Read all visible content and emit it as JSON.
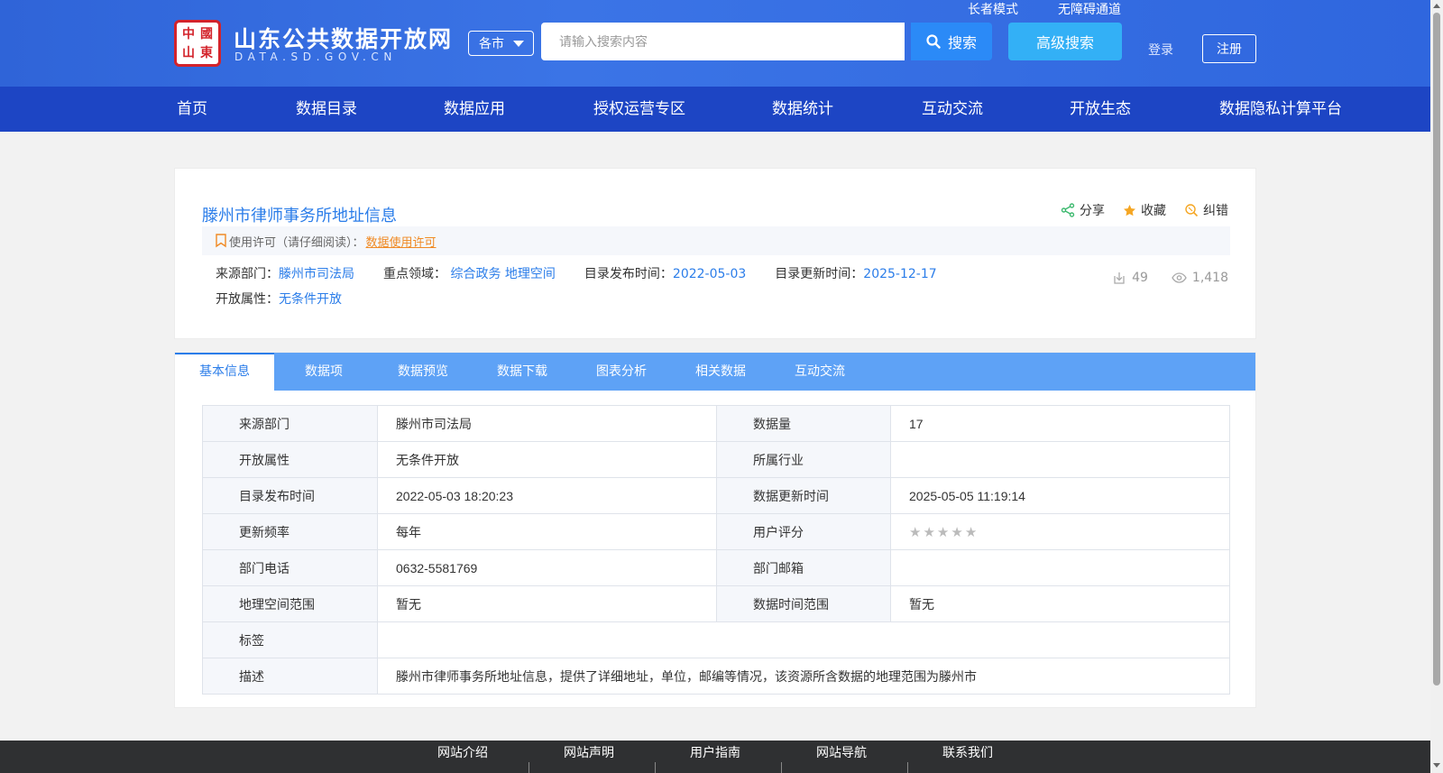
{
  "header": {
    "logo_seal_chars": [
      "中",
      "國",
      "山",
      "東"
    ],
    "site_title": "山东公共数据开放网",
    "site_domain": "DATA.SD.GOV.CN",
    "city_select": "各市",
    "search_placeholder": "请输入搜索内容",
    "search_label": "搜索",
    "advanced_search_label": "高级搜索",
    "elder_mode": "长者模式",
    "accessibility": "无障碍通道",
    "login": "登录",
    "register": "注册"
  },
  "nav": {
    "items": [
      "首页",
      "数据目录",
      "数据应用",
      "授权运营专区",
      "数据统计",
      "互动交流",
      "开放生态",
      "数据隐私计算平台"
    ]
  },
  "dataset": {
    "title": "滕州市律师事务所地址信息",
    "actions": {
      "share": "分享",
      "favorite": "收藏",
      "report": "纠错"
    },
    "license_prefix": "使用许可（请仔细阅读）：",
    "license_link": "数据使用许可",
    "meta": {
      "source_label": "来源部门：",
      "source_value": "滕州市司法局",
      "domain_label": "重点领域：",
      "domain_value": "综合政务 地理空间",
      "publish_label": "目录发布时间：",
      "publish_value": "2022-05-03",
      "update_label": "目录更新时间：",
      "update_value": "2025-12-17",
      "open_label": "开放属性：",
      "open_value": "无条件开放"
    },
    "stats": {
      "downloads": "49",
      "views": "1,418"
    }
  },
  "tabs": [
    "基本信息",
    "数据项",
    "数据预览",
    "数据下载",
    "图表分析",
    "相关数据",
    "互动交流"
  ],
  "info_table": {
    "rows": [
      {
        "k1": "来源部门",
        "v1": "滕州市司法局",
        "k2": "数据量",
        "v2": "17"
      },
      {
        "k1": "开放属性",
        "v1": "无条件开放",
        "k2": "所属行业",
        "v2": ""
      },
      {
        "k1": "目录发布时间",
        "v1": "2022-05-03 18:20:23",
        "k2": "数据更新时间",
        "v2": "2025-05-05 11:19:14"
      },
      {
        "k1": "更新频率",
        "v1": "每年",
        "k2": "用户评分",
        "v2": ""
      },
      {
        "k1": "部门电话",
        "v1": "0632-5581769",
        "k2": "部门邮箱",
        "v2": ""
      },
      {
        "k1": "地理空间范围",
        "v1": "暂无",
        "k2": "数据时间范围",
        "v2": "暂无"
      }
    ],
    "rating": 0,
    "tags_label": "标签",
    "tags_value": "",
    "desc_label": "描述",
    "desc_value": "滕州市律师事务所地址信息，提供了详细地址，单位，邮编等情况，该资源所含数据的地理范围为滕州市"
  },
  "footer": {
    "links": [
      "网站介绍",
      "网站声明",
      "用户指南",
      "网站导航",
      "联系我们"
    ]
  },
  "colors": {
    "header_blue": "#3b74e6",
    "nav_blue": "#1d45c4",
    "tab_blue": "#5ea2f6",
    "link_blue": "#2b7de9",
    "license_orange": "#f08a24",
    "footer_dark": "#2f3032"
  }
}
